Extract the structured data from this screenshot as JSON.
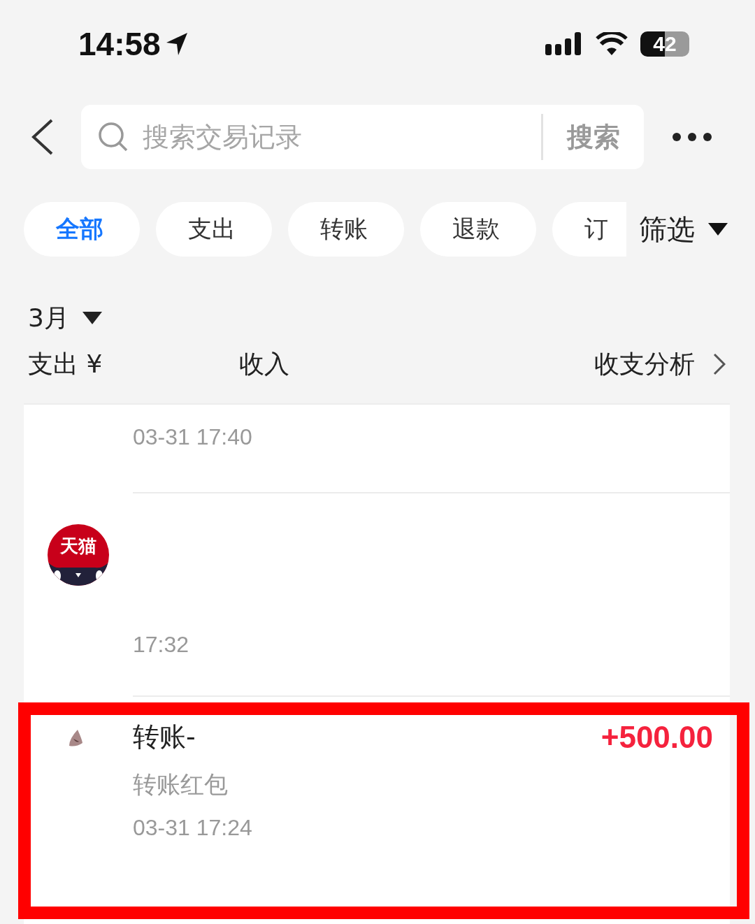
{
  "status_bar": {
    "time": "14:58",
    "battery": "42"
  },
  "search": {
    "placeholder": "搜索交易记录",
    "button": "搜索"
  },
  "filters": [
    {
      "label": "全部",
      "selected": true
    },
    {
      "label": "支出",
      "selected": false
    },
    {
      "label": "转账",
      "selected": false
    },
    {
      "label": "退款",
      "selected": false
    },
    {
      "label": "订",
      "selected": false
    }
  ],
  "filter_menu": "筛选",
  "month": "3月",
  "summary": {
    "expense": "支出 ¥",
    "income": "收入",
    "analysis": "收支分析"
  },
  "records": [
    {
      "kind": "plain",
      "time": "03-31 17:40",
      "highlighted": false
    },
    {
      "kind": "shop",
      "logo_text": "天猫",
      "time": "17:32",
      "highlighted": false
    },
    {
      "kind": "transfer",
      "title": "转账-",
      "subtitle": "转账红包",
      "time": "03-31 17:24",
      "amount": "+500.00",
      "highlighted": true
    }
  ]
}
